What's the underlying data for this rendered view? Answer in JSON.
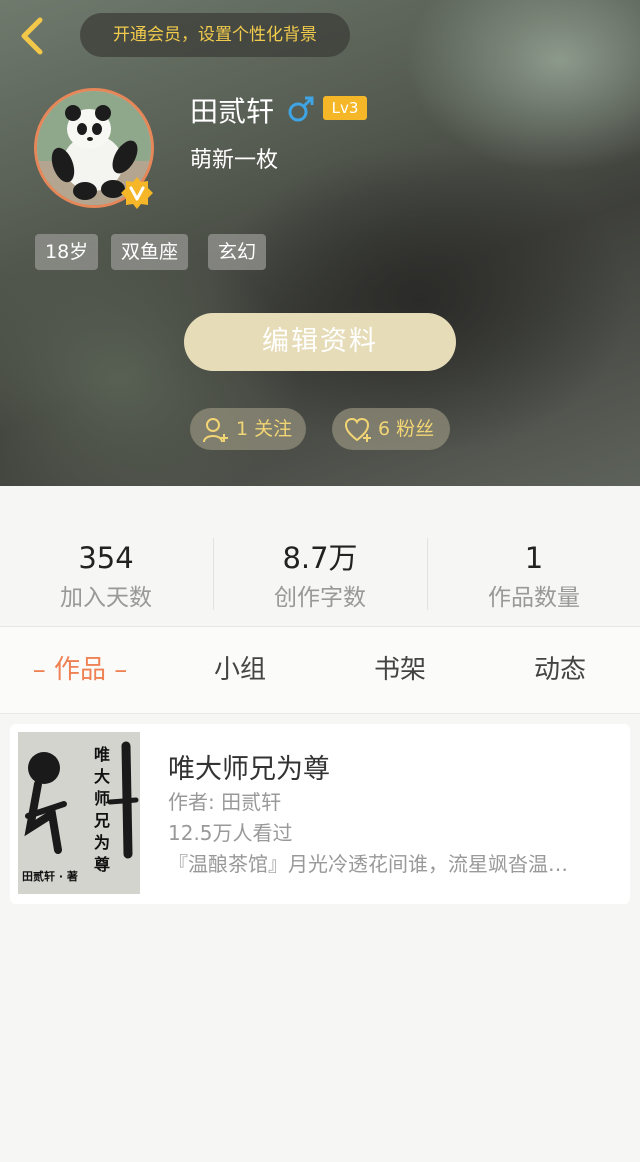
{
  "header": {
    "vip_banner": "开通会员，设置个性化背景"
  },
  "profile": {
    "name": "田贰轩",
    "gender_icon": "male-icon",
    "level": "Lv3",
    "bio": "萌新一枚",
    "tags": [
      "18岁",
      "双鱼座",
      "玄幻"
    ],
    "edit_button": "编辑资料",
    "following": "1 关注",
    "fans": "6 粉丝",
    "accent_color": "#f5b727"
  },
  "stats": [
    {
      "value": "354",
      "label": "加入天数"
    },
    {
      "value": "8.7万",
      "label": "创作字数"
    },
    {
      "value": "1",
      "label": "作品数量"
    }
  ],
  "tabs": [
    {
      "label": "– 作品 –",
      "active": true
    },
    {
      "label": "小组",
      "active": false
    },
    {
      "label": "书架",
      "active": false
    },
    {
      "label": "动态",
      "active": false
    }
  ],
  "books": [
    {
      "title": "唯大师兄为尊",
      "author": "作者: 田贰轩",
      "views": "12.5万人看过",
      "description": "『温酿茶馆』月光冷透花间谁，流星飒沓温…",
      "cover_title": "唯大师兄为尊",
      "cover_author": "田贰轩 · 著"
    }
  ]
}
